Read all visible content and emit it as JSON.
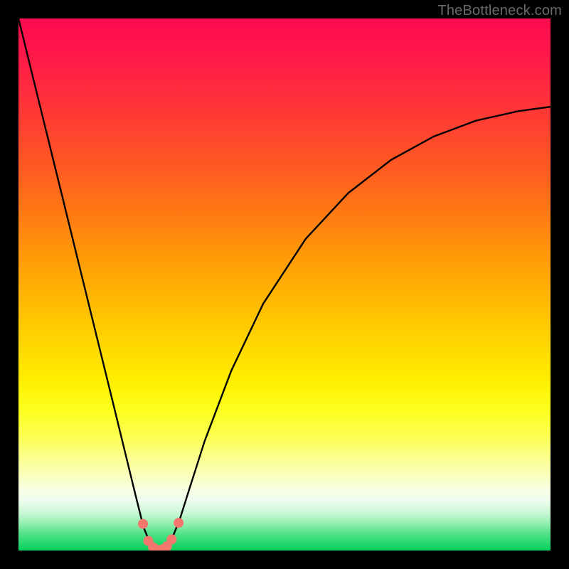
{
  "attribution": "TheBottleneck.com",
  "colors": {
    "dot_fill": "#f3776d",
    "curve_stroke": "#000000"
  },
  "chart_data": {
    "type": "line",
    "title": "",
    "xlabel": "",
    "ylabel": "",
    "xlim": [
      0,
      100
    ],
    "ylim": [
      0,
      100
    ],
    "note": "Values estimated from pixel positions; background is a vertical rainbow gradient from red (top) to green (bottom).",
    "series": [
      {
        "name": "bottleneck-curve",
        "x": [
          0,
          3,
          6,
          9,
          12,
          15,
          18,
          20,
          22,
          23.5,
          24.8,
          25.5,
          26.3,
          27.0,
          28.0,
          29.0,
          30.3,
          32.0,
          35.0,
          40.0,
          46.0,
          54.0,
          62.0,
          70.0,
          78.0,
          86.0,
          94.0,
          100.0
        ],
        "y": [
          100.0,
          87.8,
          75.6,
          63.4,
          51.2,
          39.0,
          26.8,
          18.6,
          10.4,
          4.4,
          1.2,
          0.3,
          0.0,
          0.2,
          0.9,
          2.6,
          5.8,
          11.2,
          20.6,
          33.8,
          46.4,
          58.6,
          67.2,
          73.4,
          77.8,
          80.8,
          82.6,
          83.4
        ]
      }
    ],
    "dots": {
      "name": "highlight-dots",
      "x": [
        23.4,
        24.4,
        25.3,
        26.1,
        27.0,
        27.9,
        28.8,
        30.1
      ],
      "y": [
        5.0,
        1.8,
        0.6,
        0.1,
        0.2,
        0.8,
        2.1,
        5.2
      ],
      "radius_px": 7
    }
  }
}
